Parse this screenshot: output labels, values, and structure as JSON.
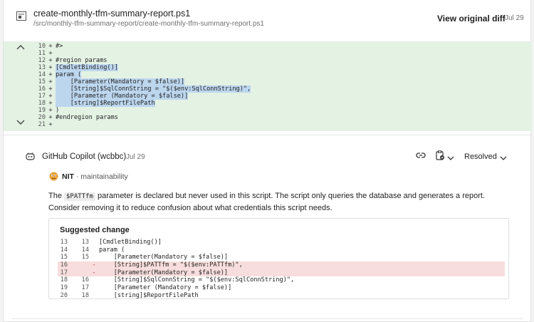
{
  "header": {
    "file_name": "create-monthly-tfm-summary-report.ps1",
    "file_path": "/src/monthly-tfm-summary-report/create-monthly-tfm-summary-report.ps1",
    "view_diff_label": "View original diff",
    "date": "Jul 29"
  },
  "diff": {
    "lines": [
      {
        "num": "10",
        "mark": "+",
        "code": "#>",
        "selected": false
      },
      {
        "num": "11",
        "mark": "+",
        "code": "",
        "selected": false
      },
      {
        "num": "12",
        "mark": "+",
        "code": "#region params",
        "selected": false
      },
      {
        "num": "13",
        "mark": "+",
        "code": "[CmdletBinding()]",
        "selected": true
      },
      {
        "num": "14",
        "mark": "+",
        "code": "param (",
        "selected": true
      },
      {
        "num": "15",
        "mark": "+",
        "code": "    [Parameter(Mandatory = $false)]",
        "selected": true
      },
      {
        "num": "16",
        "mark": "+",
        "code": "    [String]$SqlConnString = \"$($env:SqlConnString)\",",
        "selected": true
      },
      {
        "num": "17",
        "mark": "+",
        "code": "    [Parameter (Mandatory = $false)]",
        "selected": true
      },
      {
        "num": "18",
        "mark": "+",
        "code": "    [string]$ReportFilePath",
        "selected": true
      },
      {
        "num": "19",
        "mark": "+",
        "code": ")",
        "selected": false
      },
      {
        "num": "20",
        "mark": "+",
        "code": "#endregion params",
        "selected": false
      },
      {
        "num": "21",
        "mark": "+",
        "code": "",
        "selected": false
      }
    ]
  },
  "comment": {
    "author": "GitHub Copilot (wcbbc)",
    "date": "Jul 29",
    "status_label": "Resolved",
    "tag_label": "NIT",
    "category": "maintainability",
    "body_before": "The ",
    "inline_code": "$PATTfm",
    "body_after": " parameter is declared but never used in this script. The script only queries the database and generates a report. Consider removing it to reduce confusion about what credentials this script needs."
  },
  "suggestion": {
    "title": "Suggested change",
    "lines": [
      {
        "old": "13",
        "new": "13",
        "mark": "",
        "code": "[CmdletBinding()]",
        "deleted": false
      },
      {
        "old": "14",
        "new": "14",
        "mark": "",
        "code": "param (",
        "deleted": false
      },
      {
        "old": "15",
        "new": "15",
        "mark": "",
        "code": "    [Parameter(Mandatory = $false)]",
        "deleted": false
      },
      {
        "old": "16",
        "new": "",
        "mark": "-",
        "code": "    [String]$PATTfm = \"$($env:PATTfm)\",",
        "deleted": true
      },
      {
        "old": "17",
        "new": "",
        "mark": "-",
        "code": "    [Parameter(Mandatory = $false)]",
        "deleted": true
      },
      {
        "old": "18",
        "new": "16",
        "mark": "",
        "code": "    [String]$SqlConnString = \"$($env:SqlConnString)\",",
        "deleted": false
      },
      {
        "old": "19",
        "new": "17",
        "mark": "",
        "code": "    [Parameter (Mandatory = $false)]",
        "deleted": false
      },
      {
        "old": "20",
        "new": "18",
        "mark": "",
        "code": "    [string]$ReportFilePath",
        "deleted": false
      }
    ]
  },
  "colors": {
    "diff_added_bg": "#e4f2e4",
    "selection_bg": "#bcd6ee",
    "deleted_bg": "#f7dddd",
    "nit_icon": "#e8a23a"
  },
  "icons": {
    "file": "file-icon",
    "collapse_up": "chevron-up-icon",
    "collapse_down": "chevron-down-icon",
    "copilot": "copilot-icon",
    "link": "link-icon",
    "status": "clipboard-check-icon",
    "nit": "nit-face-icon"
  }
}
